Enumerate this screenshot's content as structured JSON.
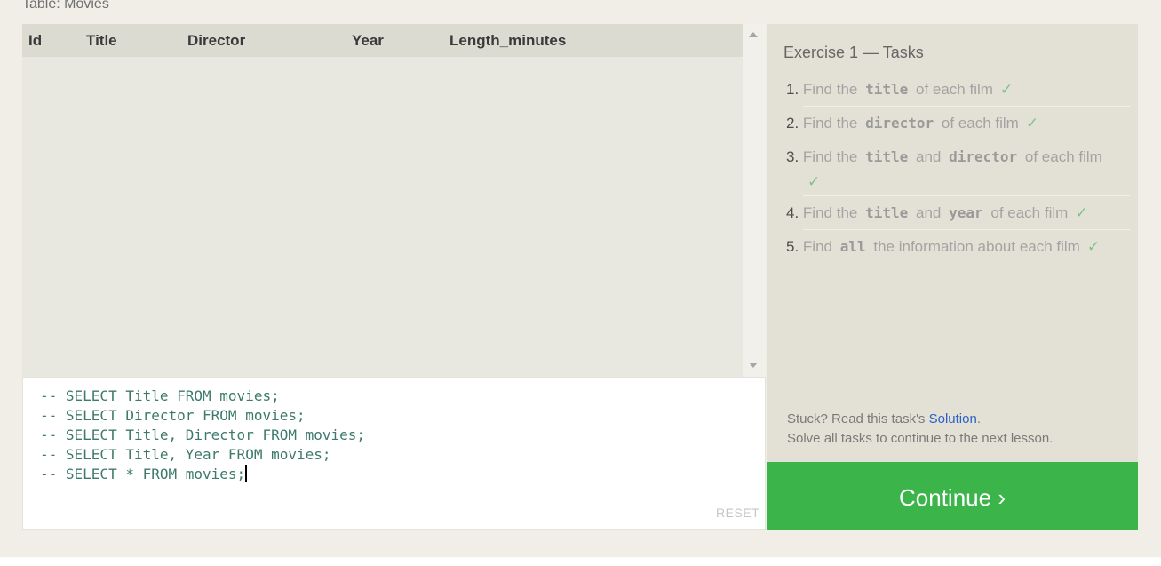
{
  "table_caption": "Table: Movies",
  "results": {
    "columns": [
      "Id",
      "Title",
      "Director",
      "Year",
      "Length_minutes"
    ]
  },
  "editor": {
    "lines": [
      "-- SELECT Title FROM movies;",
      "-- SELECT Director FROM movies;",
      "-- SELECT Title, Director FROM movies;",
      "-- SELECT Title, Year FROM movies;",
      "-- SELECT * FROM movies;"
    ],
    "reset_label": "RESET"
  },
  "tasks_panel": {
    "title": "Exercise 1 — Tasks",
    "tasks": [
      {
        "num": "1.",
        "pre": "Find the",
        "code1": "title",
        "mid": "",
        "code2": "",
        "post": "of each film",
        "check": "✓"
      },
      {
        "num": "2.",
        "pre": "Find the",
        "code1": "director",
        "mid": "",
        "code2": "",
        "post": "of each film",
        "check": "✓"
      },
      {
        "num": "3.",
        "pre": "Find the",
        "code1": "title",
        "mid": "and",
        "code2": "director",
        "post": "of each film",
        "check": "✓"
      },
      {
        "num": "4.",
        "pre": "Find the",
        "code1": "title",
        "mid": "and",
        "code2": "year",
        "post": "of each film",
        "check": "✓"
      },
      {
        "num": "5.",
        "pre": "Find",
        "code1": "all",
        "mid": "",
        "code2": "",
        "post": "the information about each film",
        "check": "✓"
      }
    ],
    "stuck_text": "Stuck? Read this task's",
    "solution_link": "Solution",
    "stuck_period": ".",
    "solve_all_text": "Solve all tasks to continue to the next lesson."
  },
  "continue_label": "Continue ›",
  "colors": {
    "continue_bg": "#3bb54a",
    "check": "#7cc48a",
    "link": "#2c62c7",
    "code_text": "#3d7a6b"
  }
}
